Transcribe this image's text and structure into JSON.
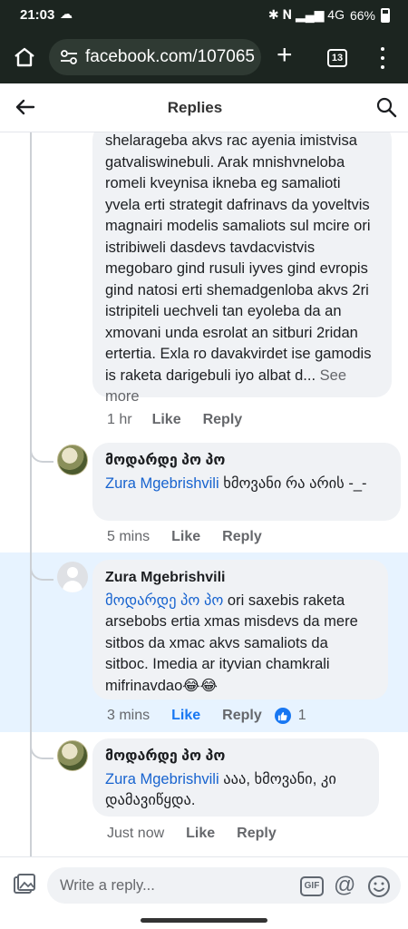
{
  "status": {
    "time": "21:03",
    "cloud": "☁",
    "icons": "✱ 𝐍 ▂▄▆ 4G",
    "battery": "66%"
  },
  "browser": {
    "url": "facebook.com/107065",
    "tab_count": "13"
  },
  "header": {
    "title": "Replies"
  },
  "comments": [
    {
      "text": "shelarageba akvs rac ayenia imistvisa gatvaliswinebuli. Arak mnishvneloba romeli kveynisa ikneba eg samalioti yvela erti strategit dafrinavs da yoveltvis magnairi modelis samaliots sul mcire ori istribiweli dasdevs tavdacvistvis megobaro gind rusuli iyves gind evropis gind natosi erti shemadgenloba akvs 2ri istripiteli uechveli tan eyoleba da an xmovani unda esrolat an sitburi 2ridan ertertia. Exla ro davakvirdet ise gamodis is raketa darigebuli iyo albat d...",
      "see_more": "See more",
      "time": "1 hr",
      "like": "Like",
      "reply": "Reply"
    },
    {
      "author": "მოდარდე პო პო",
      "mention": "Zura Mgebrishvili",
      "text": " ხმოვანი რა არის -_-",
      "time": "5 mins",
      "like": "Like",
      "reply": "Reply"
    },
    {
      "author": "Zura Mgebrishvili",
      "mention": "მოდარდე პო პო",
      "text": " ori saxebis raketa arsebobs ertia xmas misdevs da mere sitbos da xmac akvs samaliots da sitboc. Imedia ar ityvian chamkrali mifrinavdao😂😂",
      "time": "3 mins",
      "like": "Like",
      "reply": "Reply",
      "reaction_count": "1"
    },
    {
      "author": "მოდარდე პო პო",
      "mention": "Zura Mgebrishvili",
      "text": " ააა, ხმოვანი, კი დამავიწყდა.",
      "time": "Just now",
      "like": "Like",
      "reply": "Reply"
    }
  ],
  "footer": {
    "placeholder": "Write a reply...",
    "gif": "GIF",
    "at": "@"
  },
  "colors": {
    "browser_bg": "#1c2520",
    "link": "#1763cf",
    "highlight": "#e7f3ff",
    "like_active": "#1877f2"
  }
}
